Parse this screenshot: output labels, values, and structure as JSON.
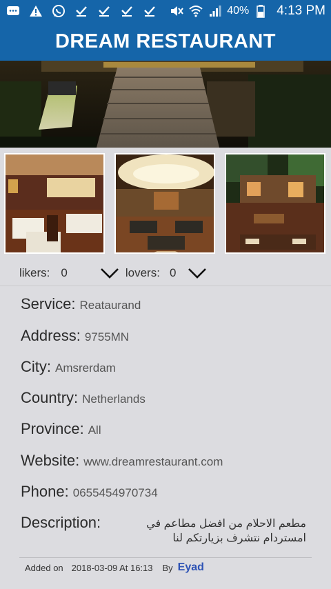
{
  "status_bar": {
    "battery": "40%",
    "time": "4:13 PM",
    "icons": [
      "messages-icon",
      "warning-icon",
      "whatsapp-icon",
      "check-icon",
      "check-icon",
      "check-icon",
      "check-icon",
      "mute-icon",
      "wifi-icon",
      "signal-icon",
      "battery-icon"
    ]
  },
  "app": {
    "title": "DREAM RESTAURANT",
    "bar_color": "#1565a9"
  },
  "reactions": {
    "likers_label": "likers:",
    "likers_count": "0",
    "lovers_label": "lovers:",
    "lovers_count": "0",
    "expand_icon": "chevron-down-icon"
  },
  "details": {
    "service": {
      "label": "Service:",
      "value": "Reataurand"
    },
    "address": {
      "label": "Address:",
      "value": "9755MN"
    },
    "city": {
      "label": "City:",
      "value": "Amsrerdam"
    },
    "country": {
      "label": "Country:",
      "value": "Netherlands"
    },
    "province": {
      "label": "Province:",
      "value": "All"
    },
    "website": {
      "label": "Website:",
      "value": "www.dreamrestaurant.com"
    },
    "phone": {
      "label": "Phone:",
      "value": "0655454970734"
    },
    "description": {
      "label": "Description:",
      "value": "مطعم الاحلام من افضل مطاعم في امستردام نتشرف بزيارتكم لنا"
    }
  },
  "footer": {
    "added_on_label": "Added on",
    "added_on_value": "2018-03-09 At 16:13",
    "by_label": "By",
    "by_user": "Eyad",
    "user_color": "#2e53b5"
  }
}
